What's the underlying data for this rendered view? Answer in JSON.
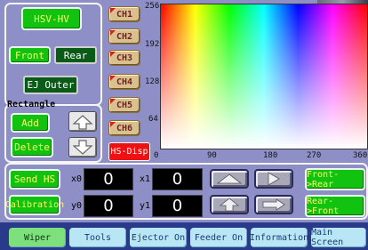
{
  "mode_button": "HSV-HV",
  "front_button": "Front",
  "rear_button": "Rear",
  "ej_outer_button": "EJ Outer",
  "rectangle": {
    "label": "Rectangle",
    "add": "Add",
    "delete": "Delete"
  },
  "channels": [
    "CH1",
    "CH2",
    "CH3",
    "CH4",
    "CH5",
    "CH6"
  ],
  "hs_disp_button": "HS-Disp",
  "plot": {
    "y_ticks": [
      "256",
      "192",
      "128",
      "64",
      "0"
    ],
    "x_ticks": [
      "90",
      "180",
      "270",
      "360"
    ]
  },
  "controls": {
    "send_hs": "Send HS",
    "calibration": "Calibration",
    "x0_label": "x0",
    "y0_label": "y0",
    "x1_label": "x1",
    "y1_label": "y1",
    "x0": "0",
    "y0": "0",
    "x1": "0",
    "y1": "0",
    "front_rear": "Front->Rear",
    "rear_front": "Rear->Front"
  },
  "tabs": [
    "Wiper",
    "Tools",
    "Ejector On",
    "Feeder On",
    "Information",
    "Main Screen"
  ],
  "colors": {
    "background": "#8f8fc8",
    "green_button": "#11c211",
    "dark_green_button": "#0a5b18",
    "hs_disp": "#ee1111",
    "tab": "#b8e6f4"
  }
}
